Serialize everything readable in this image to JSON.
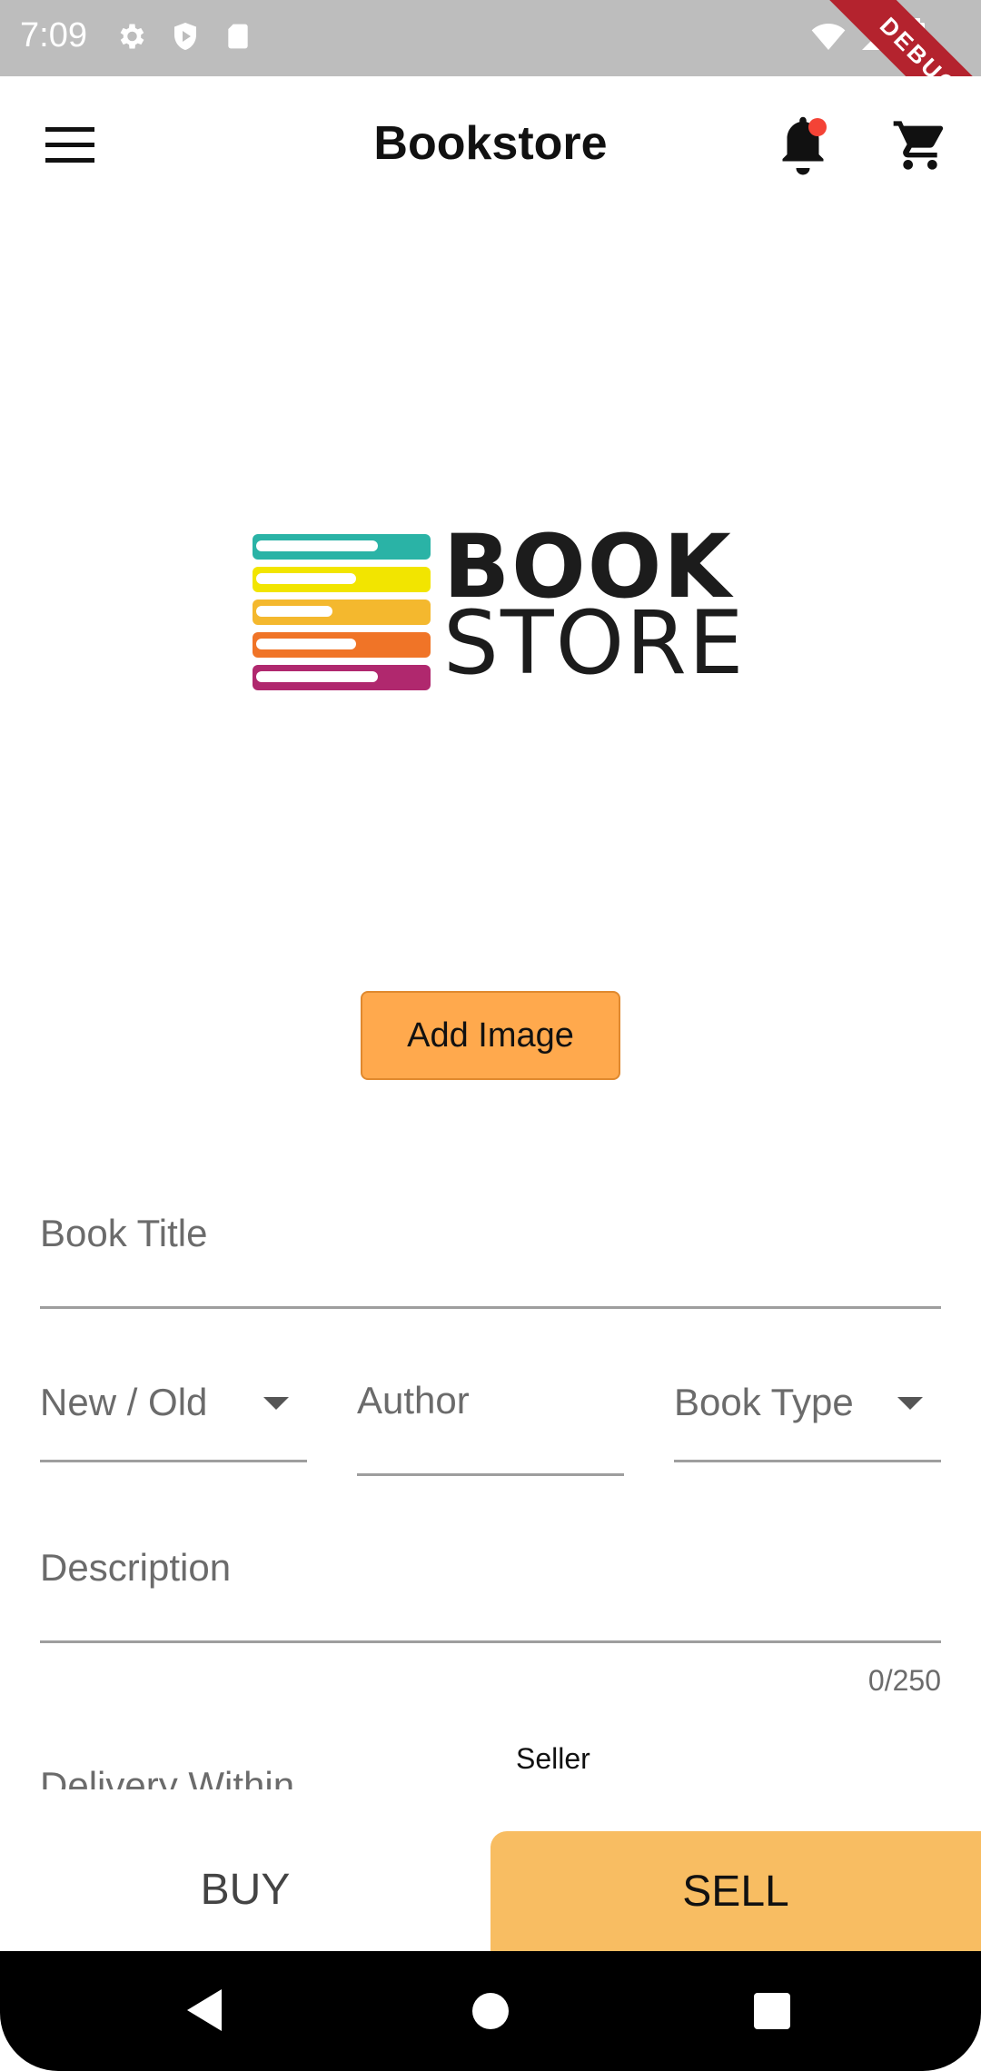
{
  "status_bar": {
    "time": "7:09",
    "icons_left": [
      "gear-icon",
      "shield-icon",
      "sd-card-icon"
    ],
    "icons_right": [
      "wifi-icon",
      "signal-icon",
      "battery-icon"
    ],
    "debug_banner": "DEBUG"
  },
  "app_bar": {
    "title": "Bookstore",
    "menu_icon": "hamburger-menu-icon",
    "notification_icon": "bell-icon",
    "cart_icon": "shopping-cart-icon",
    "notification_dot_color": "#f44336"
  },
  "logo": {
    "line1": "BOOK",
    "line2": "STORE",
    "stripe_colors": [
      "#2ab3a6",
      "#f2e500",
      "#f4b82e",
      "#f07427",
      "#b0286e"
    ]
  },
  "add_image_button": {
    "label": "Add Image",
    "color": "#ffa94d"
  },
  "form": {
    "book_title": {
      "label": "Book Title"
    },
    "condition": {
      "label": "New / Old"
    },
    "author": {
      "label": "Author"
    },
    "book_type": {
      "label": "Book Type"
    },
    "description": {
      "label": "Description",
      "counter": "0/250"
    },
    "delivery_within": {
      "label": "Delivery Within"
    }
  },
  "seller_label": "Seller",
  "tabs": {
    "buy": "BUY",
    "sell": "SELL",
    "active": "sell",
    "active_color": "#f8bd62"
  },
  "nav_bar": {
    "icons": [
      "back-icon",
      "home-icon",
      "recents-icon"
    ]
  }
}
